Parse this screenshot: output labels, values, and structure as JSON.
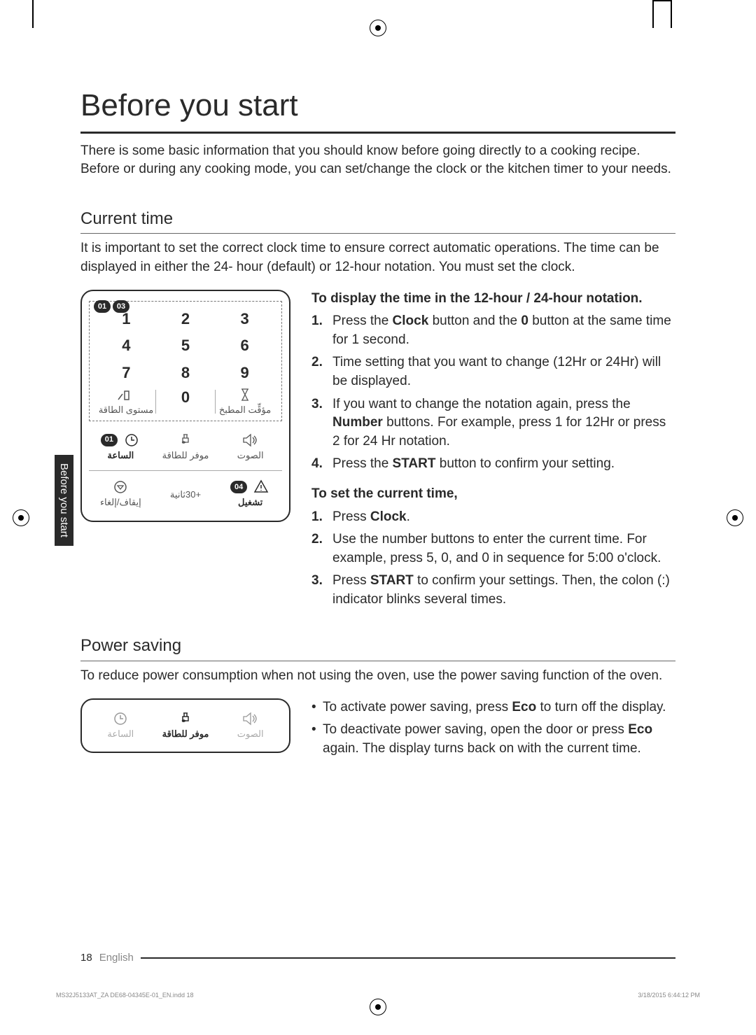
{
  "page": {
    "title": "Before you start",
    "intro": "There is some basic information that you should know before going directly to a cooking recipe. Before or during any cooking mode, you can set/change the clock or the kitchen timer to your needs.",
    "side_tab": "Before you start",
    "footer": {
      "page_number": "18",
      "language": "English"
    },
    "imprint": {
      "file": "MS32J5133AT_ZA DE68-04345E-01_EN.indd   18",
      "timestamp": "3/18/2015   6:44:12 PM"
    }
  },
  "current_time": {
    "heading": "Current time",
    "intro": "It is important to set the correct clock time to ensure correct automatic operations. The time can be displayed in either the 24- hour (default) or 12-hour notation. You must set the clock.",
    "panel": {
      "badges": [
        "01",
        "03"
      ],
      "keypad": [
        [
          "1",
          "2",
          "3"
        ],
        [
          "4",
          "5",
          "6"
        ],
        [
          "7",
          "8",
          "9"
        ]
      ],
      "row_mid": {
        "power": {
          "label": "مستوى الطاقة"
        },
        "zero": "0",
        "timer": {
          "label": "مؤقِّت المطبخ"
        }
      },
      "row_secondary": {
        "clock": {
          "badge": "01",
          "label": "الساعة"
        },
        "eco": {
          "label": "موفر للطاقة"
        },
        "sound": {
          "label": "الصوت"
        }
      },
      "row_bottom": {
        "stop": {
          "label": "إيقاف/إلغاء"
        },
        "add30": "+30ثانية",
        "start": {
          "badge": "04",
          "label": "تشغيل"
        }
      }
    },
    "procedure_a": {
      "title": "To display the time in the 12-hour / 24-hour notation.",
      "steps": [
        {
          "num": "1.",
          "text_pre": "Press the ",
          "bold1": "Clock",
          "mid": " button and the ",
          "bold2": "0",
          "post": " button at the same time for 1 second."
        },
        {
          "num": "2.",
          "text": "Time setting that you want to change (12Hr or 24Hr) will be displayed."
        },
        {
          "num": "3.",
          "text_pre": "If you want to change the notation again, press the ",
          "bold1": "Number",
          "post": " buttons. For example, press 1 for 12Hr or press 2 for 24 Hr notation."
        },
        {
          "num": "4.",
          "text_pre": "Press the ",
          "bold1": "START",
          "post": " button to confirm your setting."
        }
      ]
    },
    "procedure_b": {
      "title": "To set the current time,",
      "steps": [
        {
          "num": "1.",
          "text_pre": "Press ",
          "bold1": "Clock",
          "post": "."
        },
        {
          "num": "2.",
          "text": "Use the number buttons to enter the current time. For example, press 5, 0, and 0 in sequence for 5:00 o'clock."
        },
        {
          "num": "3.",
          "text_pre": "Press ",
          "bold1": "START",
          "post": " to confirm your settings. Then, the colon (:) indicator blinks several times."
        }
      ]
    }
  },
  "power_saving": {
    "heading": "Power saving",
    "intro": "To reduce power consumption when not using the oven, use the power saving function of the oven.",
    "panel": {
      "clock": {
        "label": "الساعة"
      },
      "eco": {
        "label": "موفر للطاقة"
      },
      "sound": {
        "label": "الصوت"
      }
    },
    "bullets": [
      {
        "pre": "To activate power saving, press ",
        "bold": "Eco",
        "post": " to turn off the display."
      },
      {
        "pre": "To deactivate power saving, open the door or press ",
        "bold": "Eco",
        "post": " again. The display turns back on with the current time."
      }
    ]
  }
}
